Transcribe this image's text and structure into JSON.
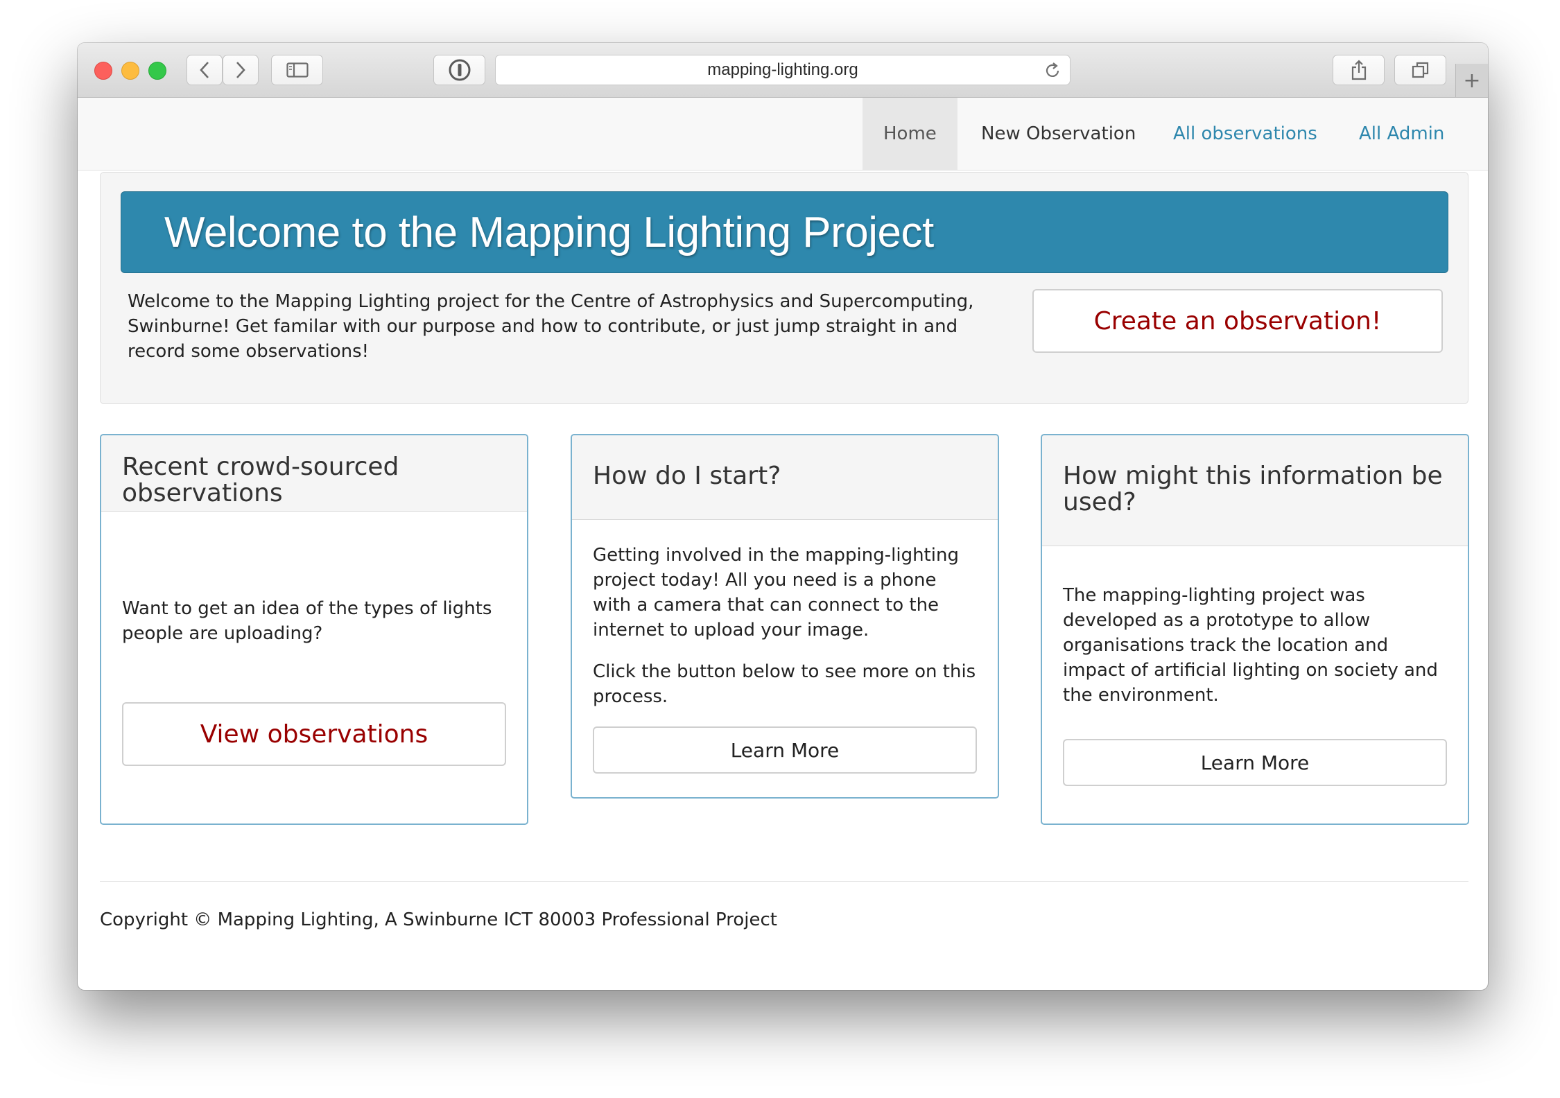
{
  "browser": {
    "url": "mapping-lighting.org",
    "icons": [
      "close-light",
      "minimize-light",
      "zoom-light",
      "back-icon",
      "forward-icon",
      "sidebar-icon",
      "password-manager-icon",
      "reload-icon",
      "share-icon",
      "tabs-icon",
      "new-tab-icon"
    ],
    "new_tab_glyph": "+"
  },
  "nav": {
    "items": [
      {
        "label": "Home",
        "active": true
      },
      {
        "label": "New Observation"
      },
      {
        "label": "All observations"
      },
      {
        "label": "All Admin"
      }
    ],
    "link_color": "#2e87ad"
  },
  "jumbotron": {
    "title": "Welcome to the Mapping Lighting Project",
    "intro": "Welcome to the Mapping Lighting project for the Centre of Astrophysics and Supercomputing, Swinburne! Get familar with our purpose and how to contribute, or just jump straight in and record some observations!",
    "cta_label": "Create an observation!",
    "banner_color": "#2e88ad",
    "cta_color": "#990000"
  },
  "cards": [
    {
      "title": "Recent crowd-sourced observations",
      "body": [
        "Want to get an idea of the types of lights people are uploading?"
      ],
      "button": "View observations"
    },
    {
      "title": "How do I start?",
      "body": [
        "Getting involved in the mapping-lighting project today! All you need is a phone with a camera that can connect to the internet to upload your image.",
        "Click the button below to see more on this process."
      ],
      "button": "Learn More"
    },
    {
      "title": "How might this information be used?",
      "body": [
        "The mapping-lighting project was developed as a prototype to allow organisations track the location and impact of artificial lighting on society and the environment."
      ],
      "button": "Learn More"
    }
  ],
  "footer": {
    "copyright": "Copyright © Mapping Lighting, A Swinburne ICT 80003 Professional Project"
  }
}
